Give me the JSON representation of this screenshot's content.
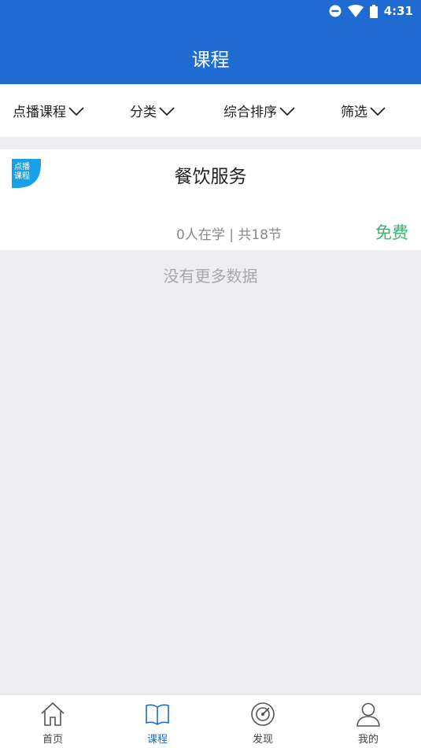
{
  "status_bar": {
    "time": "4:31",
    "icons": [
      "dnd-icon",
      "wifi-icon",
      "battery-icon"
    ]
  },
  "header": {
    "title": "课程"
  },
  "filters": [
    {
      "label": "点播课程"
    },
    {
      "label": "分类"
    },
    {
      "label": "综合排序"
    },
    {
      "label": "筛选"
    }
  ],
  "course": {
    "badge_line1": "点播",
    "badge_line2": "课程",
    "title": "餐饮服务",
    "meta": "0人在学 | 共18节",
    "price": "免费"
  },
  "empty_message": "没有更多数据",
  "tabs": [
    {
      "label": "首页",
      "icon": "home-icon"
    },
    {
      "label": "课程",
      "icon": "book-icon",
      "active": true
    },
    {
      "label": "发现",
      "icon": "compass-icon"
    },
    {
      "label": "我的",
      "icon": "user-icon"
    }
  ],
  "colors": {
    "primary": "#1f6bd1",
    "price": "#3cb371",
    "background": "#eeeef0"
  }
}
